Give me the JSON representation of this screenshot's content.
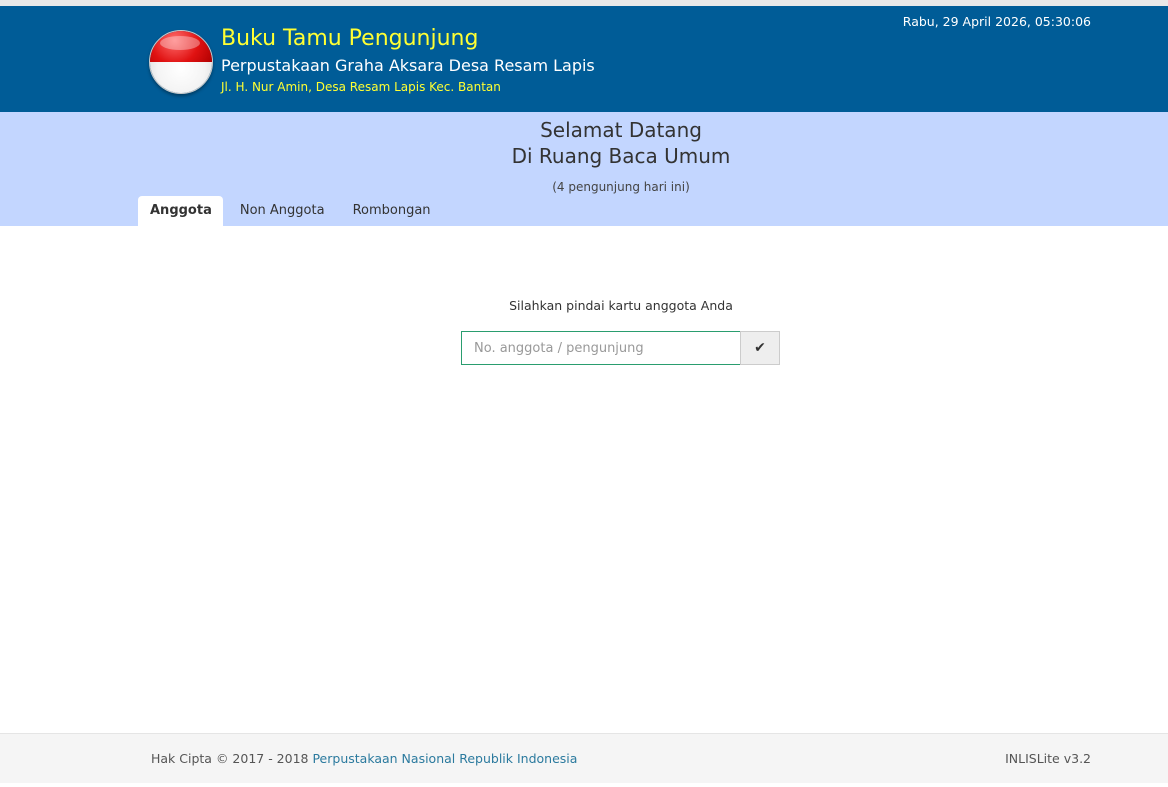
{
  "header": {
    "title": "Buku Tamu Pengunjung",
    "subtitle": "Perpustakaan Graha Aksara Desa Resam Lapis",
    "address": "Jl. H. Nur Amin, Desa Resam Lapis Kec. Bantan",
    "datetime": "Rabu, 29 April 2026, 05:30:06",
    "logo_icon": "indonesia-flag-icon",
    "colors": {
      "background": "#005c97",
      "title": "#ffff33"
    }
  },
  "welcome": {
    "line1": "Selamat Datang",
    "line2": "Di Ruang Baca Umum",
    "visitor_count": "(4 pengunjung hari ini)",
    "background": "#c3d6ff"
  },
  "tabs": [
    {
      "label": "Anggota",
      "active": true
    },
    {
      "label": "Non Anggota",
      "active": false
    },
    {
      "label": "Rombongan",
      "active": false
    }
  ],
  "scan": {
    "instruction": "Silahkan pindai kartu anggota Anda",
    "placeholder": "No. anggota / pengunjung",
    "value": "",
    "submit_icon": "checkmark-icon",
    "submit_glyph": "✔"
  },
  "footer": {
    "copyright_prefix": "Hak Cipta © 2017 - 2018 ",
    "copyright_link": "Perpustakaan Nasional Republik Indonesia",
    "version": "INLISLite v3.2",
    "link_color": "#2b7a9e"
  }
}
